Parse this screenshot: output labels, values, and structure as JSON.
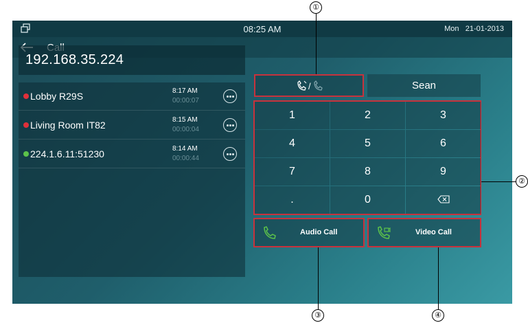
{
  "statusbar": {
    "time": "08:25 AM",
    "day": "Mon",
    "date": "21-01-2013"
  },
  "titlebar": {
    "title": "Call"
  },
  "dial_input": {
    "value": "192.168.35.224"
  },
  "history": [
    {
      "name": "Lobby R29S",
      "time": "8:17 AM",
      "duration": "00:00:07",
      "status_color": "#e0303a"
    },
    {
      "name": "Living Room IT82",
      "time": "8:15 AM",
      "duration": "00:00:04",
      "status_color": "#e0303a"
    },
    {
      "name": "224.1.6.11:51230",
      "time": "8:14 AM",
      "duration": "00:00:44",
      "status_color": "#5cc24a"
    }
  ],
  "mode_toggle": {
    "icons": [
      "audio-call-icon",
      "video-call-icon"
    ],
    "separator": "/"
  },
  "contact_button": {
    "label": "Sean"
  },
  "keypad": {
    "keys": [
      "1",
      "2",
      "3",
      "4",
      "5",
      "6",
      "7",
      "8",
      "9",
      ".",
      "0",
      "backspace-icon"
    ]
  },
  "audio_call": {
    "label": "Audio Call",
    "icon": "audio-call-icon"
  },
  "video_call": {
    "label": "Video Call",
    "icon": "video-call-icon"
  },
  "callouts": [
    "①",
    "②",
    "③",
    "④"
  ],
  "colors": {
    "highlight": "#c8323c",
    "icon_green": "#5cc24a",
    "missed_red": "#e0303a"
  }
}
